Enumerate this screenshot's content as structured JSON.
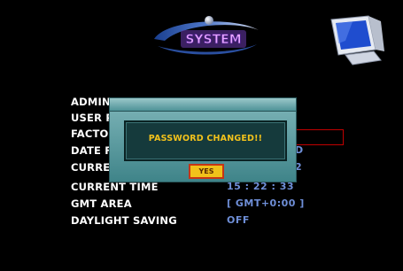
{
  "header": {
    "logo_text": "SYSTEM",
    "logo_icon": "system-logo-icon",
    "monitor_icon": "monitor-icon"
  },
  "menu": {
    "items": [
      {
        "label": "ADMIN I",
        "value": ""
      },
      {
        "label": "USER PA",
        "value": ""
      },
      {
        "label": "FACTOR",
        "value": ""
      },
      {
        "label": "DATE FO",
        "value": "D"
      },
      {
        "label": "CURREN",
        "value": "2"
      },
      {
        "label": "CURRENT TIME",
        "value": "15 : 22 : 33"
      },
      {
        "label": "GMT AREA",
        "value": "[ GMT+0:00 ]"
      },
      {
        "label": "DAYLIGHT SAVING",
        "value": "OFF"
      }
    ]
  },
  "dialog": {
    "message": "PASSWORD CHANGED!!",
    "yes_label": "YES"
  },
  "colors": {
    "background": "#000000",
    "label": "#ffffff",
    "value": "#6f8fd8",
    "dialog_teal": "#4e9297",
    "message_yellow": "#f3c21b",
    "highlight_red": "#c00000"
  }
}
